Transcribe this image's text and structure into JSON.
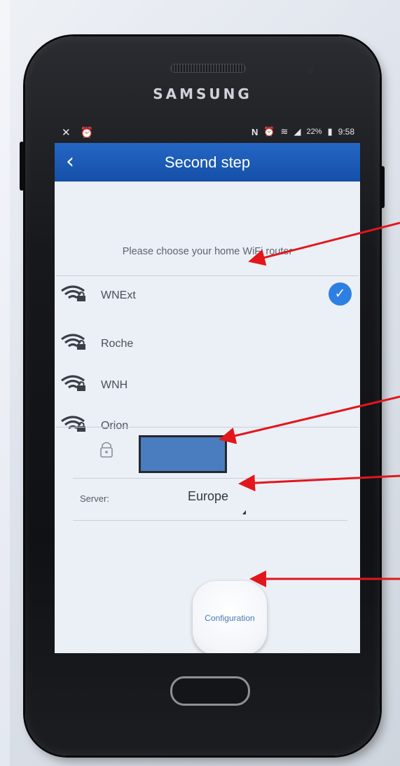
{
  "device": {
    "brand": "SAMSUNG"
  },
  "status_bar": {
    "left_icons": "✕ ⏰",
    "battery": "22%",
    "time": "9:58"
  },
  "screen": {
    "title": "Second step",
    "back_icon": "chevron-left-icon",
    "subtitle": "Please choose your home WiFi router",
    "networks": [
      {
        "name": "WNExt",
        "selected": true
      },
      {
        "name": "Roche",
        "selected": false
      },
      {
        "name": "WNH",
        "selected": false
      },
      {
        "name": "Orion",
        "selected": false
      }
    ],
    "check_glyph": "✓",
    "server_label": "Server:",
    "server_value": "Europe",
    "config_button": "Configuration"
  },
  "colors": {
    "accent": "#1a5bb8",
    "check": "#2d7fe3",
    "annotation_arrow": "#e3161b"
  }
}
